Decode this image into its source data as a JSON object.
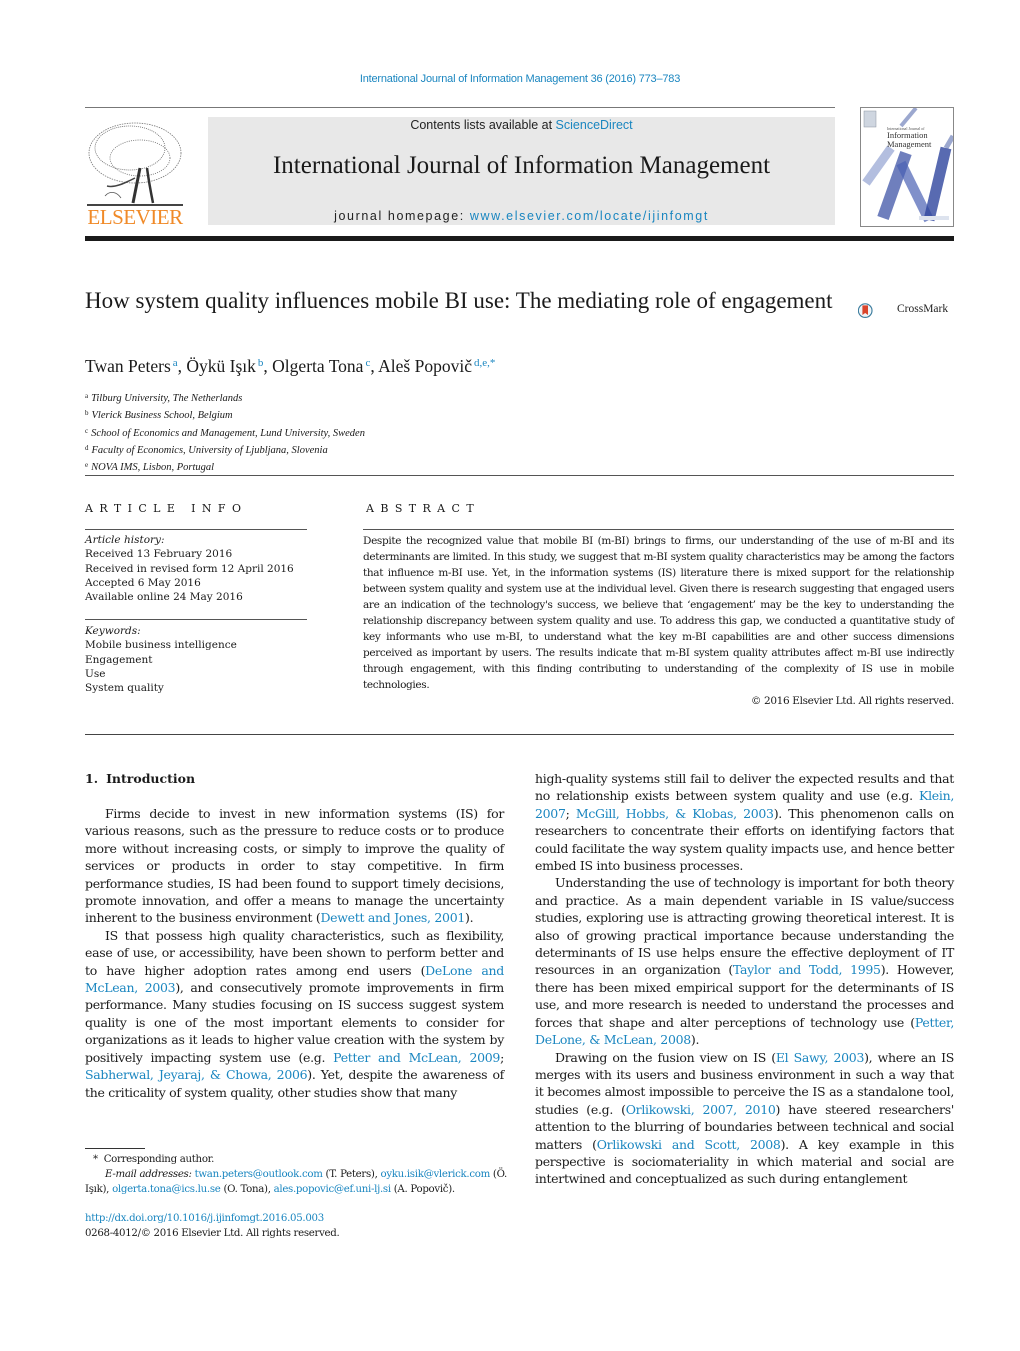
{
  "running_head": "International Journal of Information Management 36 (2016) 773–783",
  "header": {
    "publisher_logo_word": "ELSEVIER",
    "contents_prefix": "Contents lists available at ",
    "contents_link": "ScienceDirect",
    "journal_title": "International Journal of Information Management",
    "homepage_prefix": "journal homepage: ",
    "homepage_link": "www.elsevier.com/locate/ijinfomgt",
    "cover_small": "International Journal of",
    "cover_title_line1": "Information",
    "cover_title_line2": "Management"
  },
  "colors": {
    "link": "#1a86c0",
    "elsevier_orange": "#f08a28",
    "header_band": "#e8e8e8",
    "crossmark_red": "#d9442b",
    "crossmark_ring": "#3f7fa0"
  },
  "article": {
    "title": "How system quality influences mobile BI use: The mediating role of engagement",
    "crossmark_label": "CrossMark",
    "authors": [
      {
        "name": "Twan Peters",
        "sup": "a"
      },
      {
        "name": "Öykü Işık",
        "sup": "b"
      },
      {
        "name": "Olgerta Tona",
        "sup": "c"
      },
      {
        "name": "Aleš Popovič",
        "sup": "d,e,*"
      }
    ],
    "affiliations": [
      {
        "sup": "a",
        "text": "Tilburg University, The Netherlands"
      },
      {
        "sup": "b",
        "text": "Vlerick Business School, Belgium"
      },
      {
        "sup": "c",
        "text": "School of Economics and Management, Lund University, Sweden"
      },
      {
        "sup": "d",
        "text": "Faculty of Economics, University of Ljubljana, Slovenia"
      },
      {
        "sup": "e",
        "text": "NOVA IMS, Lisbon, Portugal"
      }
    ]
  },
  "article_info": {
    "label": "ARTICLE INFO",
    "history_label": "Article history:",
    "history": [
      "Received 13 February 2016",
      "Received in revised form 12 April 2016",
      "Accepted 6 May 2016",
      "Available online 24 May 2016"
    ],
    "keywords_label": "Keywords:",
    "keywords": [
      "Mobile business intelligence",
      "Engagement",
      "Use",
      "System quality"
    ]
  },
  "abstract": {
    "label": "ABSTRACT",
    "text": "Despite the recognized value that mobile BI (m-BI) brings to firms, our understanding of the use of m-BI and its determinants are limited. In this study, we suggest that m-BI system quality characteristics may be among the factors that influence m-BI use. Yet, in the information systems (IS) literature there is mixed support for the relationship between system quality and system use at the individual level. Given there is research suggesting that engaged users are an indication of the technology's success, we believe that ‘engagement’ may be the key to understanding the relationship discrepancy between system quality and use. To address this gap, we conducted a quantitative study of key informants who use m-BI, to understand what the key m-BI capabilities are and other success dimensions perceived as important by users. The results indicate that m-BI system quality attributes affect m-BI use indirectly through engagement, with this finding contributing to understanding of the complexity of IS use in mobile technologies.",
    "copyright": "© 2016 Elsevier Ltd. All rights reserved."
  },
  "intro": {
    "number": "1.",
    "heading": "Introduction",
    "left_paragraphs": [
      {
        "segments": [
          {
            "t": "Firms decide to invest in new information systems (IS) for various reasons, such as the pressure to reduce costs or to produce more without increasing costs, or simply to improve the quality of services or products in order to stay competitive. In firm performance studies, IS had been found to support timely decisions, promote innovation, and offer a means to manage the uncertainty inherent to the business environment ("
          },
          {
            "t": "Dewett and Jones, 2001",
            "link": true
          },
          {
            "t": ")."
          }
        ]
      },
      {
        "segments": [
          {
            "t": "IS that possess high quality characteristics, such as flexibility, ease of use, or accessibility, have been shown to perform better and to have higher adoption rates among end users ("
          },
          {
            "t": "DeLone and McLean, 2003",
            "link": true
          },
          {
            "t": "), and consecutively promote improvements in firm performance. Many studies focusing on IS success suggest system quality is one of the most important elements to consider for organizations as it leads to higher value creation with the system by positively impacting system use (e.g. "
          },
          {
            "t": "Petter and McLean, 2009",
            "link": true
          },
          {
            "t": "; "
          },
          {
            "t": "Sabherwal, Jeyaraj, & Chowa, 2006",
            "link": true
          },
          {
            "t": "). Yet, despite the awareness of the criticality of system quality, other studies show that many"
          }
        ]
      }
    ],
    "right_paragraphs": [
      {
        "noindent": true,
        "segments": [
          {
            "t": "high-quality systems still fail to deliver the expected results and that no relationship exists between system quality and use (e.g. "
          },
          {
            "t": "Klein, 2007",
            "link": true
          },
          {
            "t": "; "
          },
          {
            "t": "McGill, Hobbs, & Klobas, 2003",
            "link": true
          },
          {
            "t": "). This phenomenon calls on researchers to concentrate their efforts on identifying factors that could facilitate the way system quality impacts use, and hence better embed IS into business processes."
          }
        ]
      },
      {
        "segments": [
          {
            "t": "Understanding the use of technology is important for both theory and practice. As a main dependent variable in IS value/success studies, exploring use is attracting growing theoretical interest. It is also of growing practical importance because understanding the determinants of IS use helps ensure the effective deployment of IT resources in an organization ("
          },
          {
            "t": "Taylor and Todd, 1995",
            "link": true
          },
          {
            "t": "). However, there has been mixed empirical support for the determinants of IS use, and more research is needed to understand the processes and forces that shape and alter perceptions of technology use ("
          },
          {
            "t": "Petter, DeLone, & McLean, 2008",
            "link": true
          },
          {
            "t": ")."
          }
        ]
      },
      {
        "segments": [
          {
            "t": "Drawing on the fusion view on IS ("
          },
          {
            "t": "El Sawy, 2003",
            "link": true
          },
          {
            "t": "), where an IS merges with its users and business environment in such a way that it becomes almost impossible to perceive the IS as a standalone tool, studies (e.g. ("
          },
          {
            "t": "Orlikowski, 2007, 2010",
            "link": true
          },
          {
            "t": ") have steered researchers' attention to the blurring of boundaries between technical and social matters ("
          },
          {
            "t": "Orlikowski and Scott, 2008",
            "link": true
          },
          {
            "t": "). A key example in this perspective is sociomateriality in which material and social are intertwined and conceptualized as such during entanglement"
          }
        ]
      }
    ]
  },
  "footnotes": {
    "corresponding_mark": "*",
    "corresponding_text": "Corresponding author.",
    "email_label": "E-mail addresses:",
    "emails": [
      {
        "email": "twan.peters@outlook.com",
        "name": "(T. Peters)"
      },
      {
        "email": "oyku.isik@vlerick.com",
        "name": "(Ö. Işık)"
      },
      {
        "email": "olgerta.tona@ics.lu.se",
        "name": "(O. Tona)"
      },
      {
        "email": "ales.popovic@ef.uni-lj.si",
        "name": "(A. Popovič)."
      }
    ],
    "doi": "http://dx.doi.org/10.1016/j.ijinfomgt.2016.05.003",
    "issn_copyright": "0268-4012/© 2016 Elsevier Ltd. All rights reserved."
  }
}
